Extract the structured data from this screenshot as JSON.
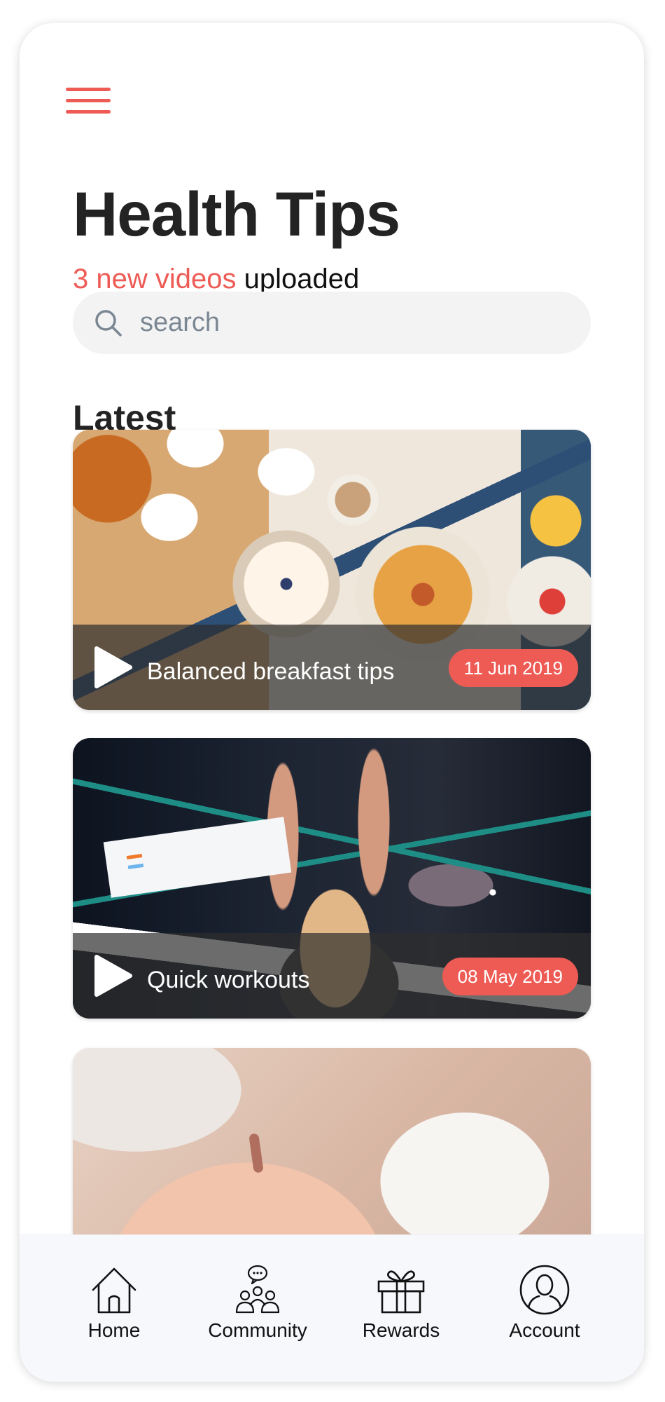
{
  "header": {
    "menu_icon": "hamburger-menu-icon",
    "title": "Health Tips",
    "subtitle_accent": "3 new videos",
    "subtitle_rest": "uploaded"
  },
  "search": {
    "placeholder": "search",
    "icon": "search-icon"
  },
  "section": {
    "title": "Latest"
  },
  "videos": [
    {
      "title": "Balanced breakfast tips",
      "date": "11 Jun 2019",
      "thumbnail": "breakfast-table"
    },
    {
      "title": "Quick workouts",
      "date": "08 May 2019",
      "thumbnail": "fitness-class"
    },
    {
      "title": "",
      "date": "",
      "thumbnail": "sleeping-baby"
    }
  ],
  "bottom_nav": {
    "items": [
      {
        "label": "Home",
        "icon": "home-icon"
      },
      {
        "label": "Community",
        "icon": "community-icon"
      },
      {
        "label": "Rewards",
        "icon": "gift-icon"
      },
      {
        "label": "Account",
        "icon": "account-icon"
      }
    ]
  },
  "colors": {
    "accent": "#ee5b55",
    "title": "#232323",
    "search_bg": "#f3f3f4",
    "nav_bg": "#f6f8fc"
  }
}
